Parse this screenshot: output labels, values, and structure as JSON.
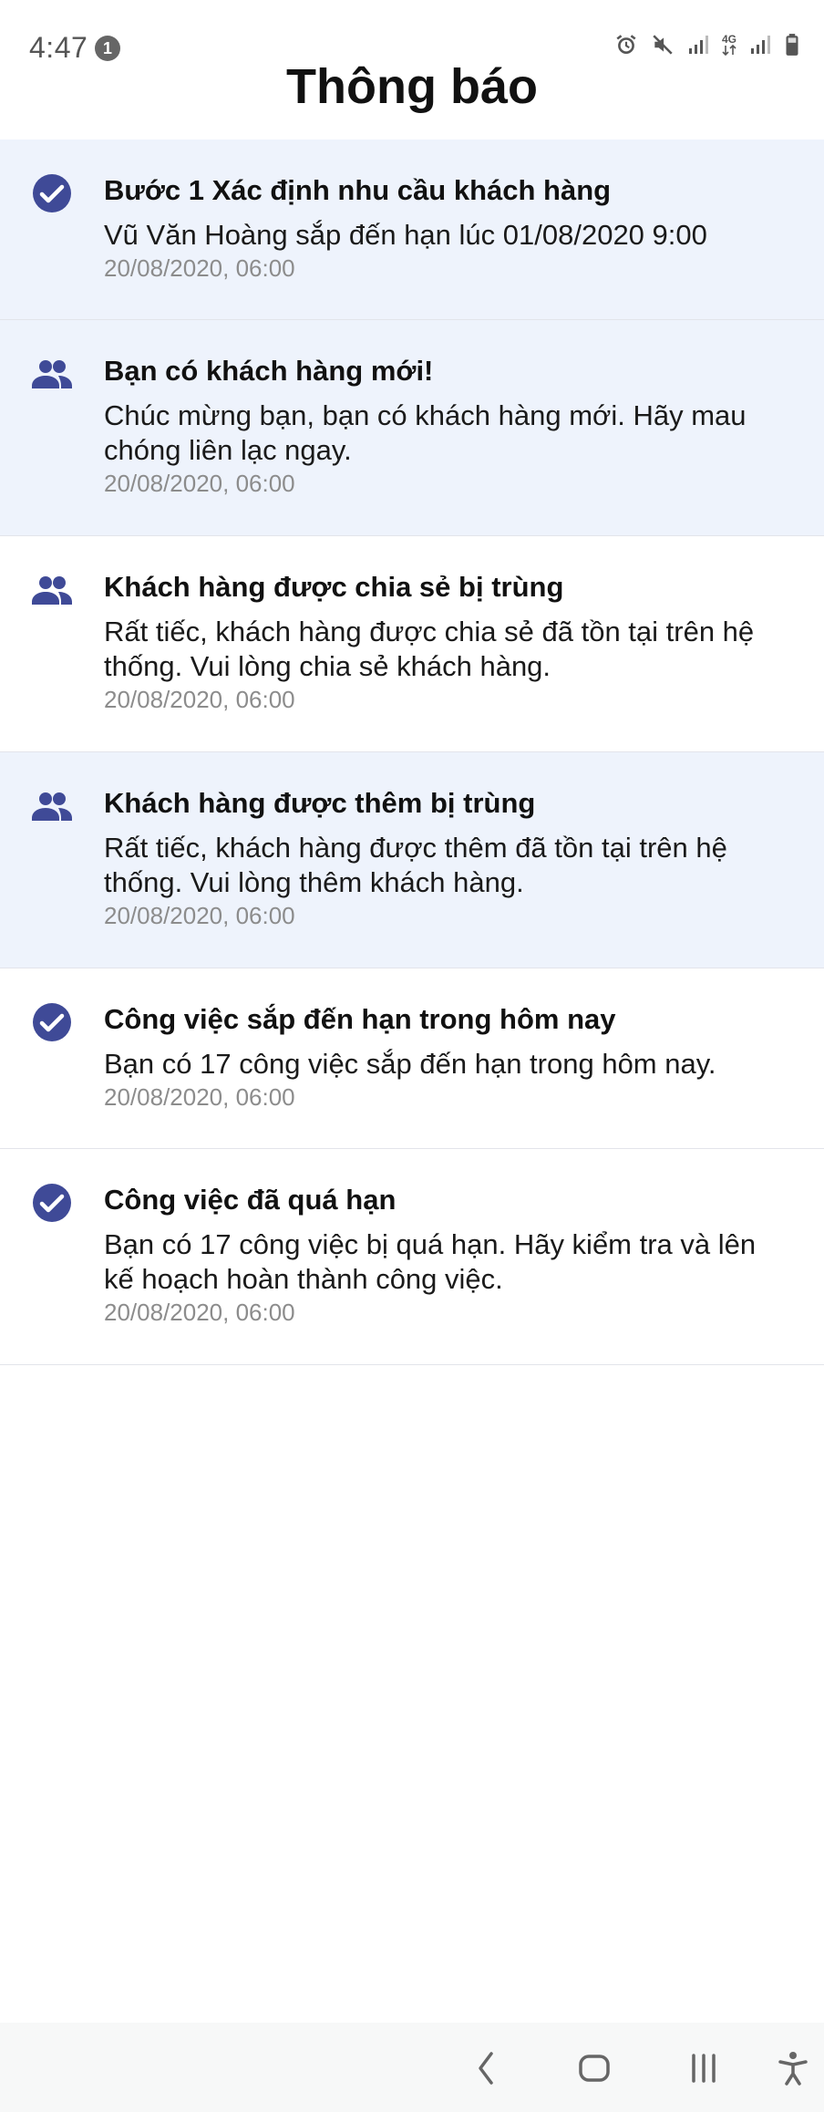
{
  "status_bar": {
    "time": "4:47",
    "notification_count": "1",
    "network_label": "4G"
  },
  "header": {
    "title": "Thông báo"
  },
  "colors": {
    "icon": "#3f4a97",
    "unread_bg": "#eef3fc",
    "read_bg": "#ffffff",
    "timestamp": "#8c8c8c"
  },
  "notifications": [
    {
      "icon": "check-circle-icon",
      "unread": true,
      "title": "Bước 1 Xác định nhu cầu khách hàng",
      "message": "Vũ Văn Hoàng sắp đến hạn lúc 01/08/2020 9:00",
      "time": "20/08/2020, 06:00"
    },
    {
      "icon": "people-icon",
      "unread": true,
      "title": "Bạn có khách hàng mới!",
      "message": "Chúc mừng bạn, bạn có khách hàng mới. Hãy mau chóng liên lạc ngay.",
      "time": "20/08/2020, 06:00"
    },
    {
      "icon": "people-icon",
      "unread": false,
      "title": "Khách hàng được chia sẻ bị trùng",
      "message": "Rất tiếc, khách hàng được chia sẻ đã tồn tại trên hệ thống. Vui lòng chia sẻ khách hàng.",
      "time": "20/08/2020, 06:00"
    },
    {
      "icon": "people-icon",
      "unread": true,
      "title": "Khách hàng được thêm bị trùng",
      "message": "Rất tiếc, khách hàng được thêm đã tồn tại trên hệ thống. Vui lòng thêm khách hàng.",
      "time": "20/08/2020, 06:00"
    },
    {
      "icon": "check-circle-icon",
      "unread": false,
      "title": "Công việc sắp đến hạn trong hôm nay",
      "message": "Bạn có 17 công việc sắp đến hạn trong hôm nay.",
      "time": "20/08/2020, 06:00"
    },
    {
      "icon": "check-circle-icon",
      "unread": false,
      "title": "Công việc đã quá hạn",
      "message": "Bạn có 17 công việc bị quá hạn. Hãy kiểm tra và lên kế hoạch hoàn thành công việc.",
      "time": "20/08/2020, 06:00"
    }
  ],
  "nav_bar": {
    "buttons": [
      "back-icon",
      "home-icon",
      "recents-icon",
      "accessibility-icon"
    ]
  }
}
